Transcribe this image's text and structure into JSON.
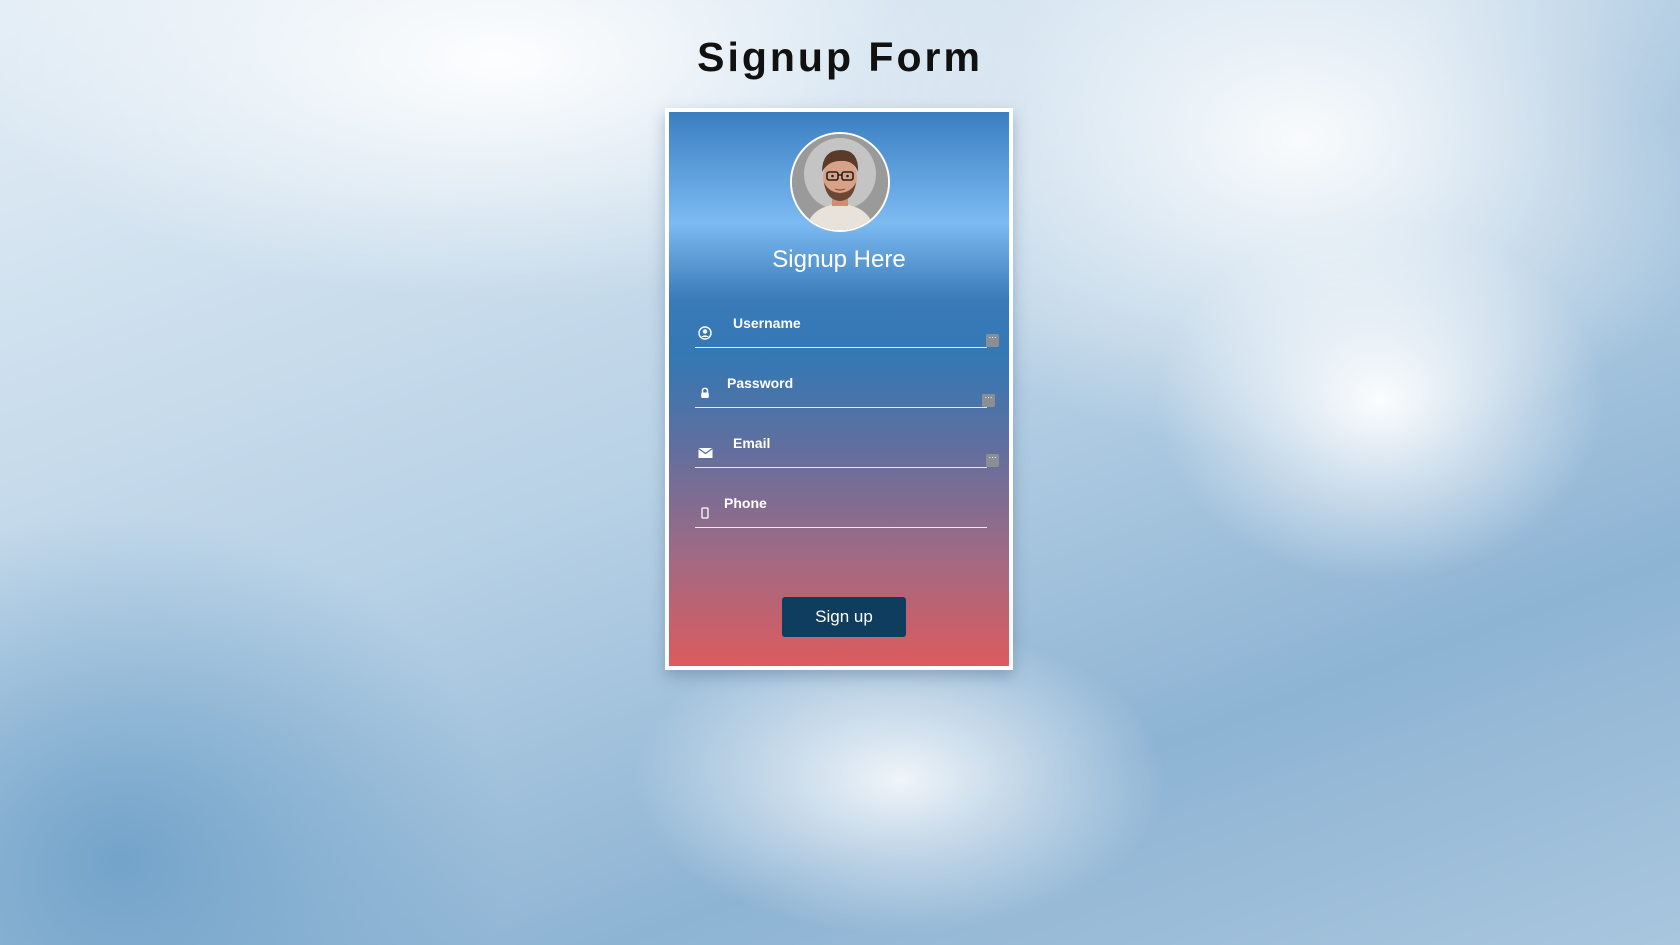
{
  "page": {
    "title": "Signup Form"
  },
  "card": {
    "heading": "Signup Here",
    "avatar_alt": "profile photo"
  },
  "form": {
    "fields": [
      {
        "name": "username",
        "placeholder": "Username",
        "icon": "user-circle-icon"
      },
      {
        "name": "password",
        "placeholder": "Password",
        "icon": "lock-icon"
      },
      {
        "name": "email",
        "placeholder": "Email",
        "icon": "envelope-icon"
      },
      {
        "name": "phone",
        "placeholder": "Phone",
        "icon": "mobile-phone-icon"
      }
    ],
    "submit_label": "Sign up"
  },
  "colors": {
    "button": "#0f3d5e",
    "card_top": "#3a7fc1",
    "card_bottom": "#dc5b5e"
  }
}
